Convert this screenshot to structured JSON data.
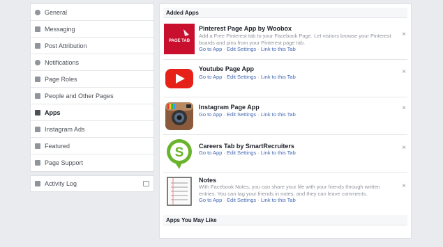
{
  "sidebar": {
    "items": [
      {
        "label": "General",
        "icon": "gear-icon"
      },
      {
        "label": "Messaging",
        "icon": "messaging-icon"
      },
      {
        "label": "Post Attribution",
        "icon": "flag-icon"
      },
      {
        "label": "Notifications",
        "icon": "globe-icon"
      },
      {
        "label": "Page Roles",
        "icon": "person-icon"
      },
      {
        "label": "People and Other Pages",
        "icon": "people-icon"
      },
      {
        "label": "Apps",
        "icon": "cube-icon",
        "active": true
      },
      {
        "label": "Instagram Ads",
        "icon": "instagram-icon"
      },
      {
        "label": "Featured",
        "icon": "star-icon"
      },
      {
        "label": "Page Support",
        "icon": "facebook-icon"
      }
    ],
    "activity_log": "Activity Log"
  },
  "main": {
    "added_apps_header": "Added Apps",
    "apps_you_may_like_header": "Apps You May Like",
    "link_go": "Go to App",
    "link_edit": "Edit Settings",
    "link_tab": "Link to this Tab",
    "sep": "·",
    "close": "×",
    "apps": [
      {
        "title": "Pinterest Page App by Woobox",
        "desc": "Add a Free Pinterest tab to your Facebook Page. Let visitors browse your Pinterest boards and pins from your Pinterest page tab.",
        "icon_text": "PAGE TAB",
        "colors": {
          "bg": "#c8102e"
        }
      },
      {
        "title": "Youtube Page App",
        "desc": "",
        "colors": {
          "bg": "#e62117"
        }
      },
      {
        "title": "Instagram Page App",
        "desc": "",
        "colors": {
          "bg": "#8a5a3c"
        }
      },
      {
        "title": "Careers Tab by SmartRecruiters",
        "desc": "",
        "icon_text": "S",
        "colors": {
          "bg": "#6ab42d"
        }
      },
      {
        "title": "Notes",
        "desc": "With Facebook Notes, you can share your life with your friends through written entries. You can tag your friends in notes, and they can leave comments.",
        "colors": {
          "bg": "#f5f5f5"
        }
      }
    ]
  }
}
